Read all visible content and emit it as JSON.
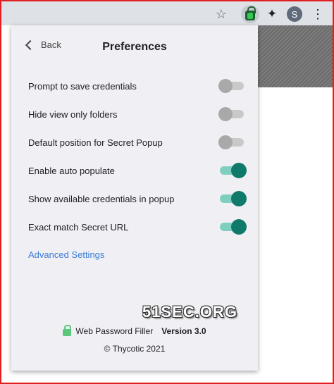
{
  "browser": {
    "avatar_letter": "S",
    "icons": [
      "star-icon",
      "lock-extension-icon",
      "puzzle-icon",
      "avatar",
      "kebab-menu-icon"
    ]
  },
  "popup": {
    "back_label": "Back",
    "title": "Preferences",
    "settings": [
      {
        "label": "Prompt to save credentials",
        "enabled": false
      },
      {
        "label": "Hide view only folders",
        "enabled": false
      },
      {
        "label": "Default position for Secret Popup",
        "enabled": false
      },
      {
        "label": "Enable auto populate",
        "enabled": true
      },
      {
        "label": "Show available credentials in popup",
        "enabled": true
      },
      {
        "label": "Exact match Secret URL",
        "enabled": true
      }
    ],
    "advanced_link": "Advanced Settings",
    "footer": {
      "product": "Web Password Filler",
      "version": "Version 3.0",
      "copyright": "© Thycotic 2021"
    }
  },
  "watermark": "51SEC.ORG",
  "colors": {
    "toggle_on": "#0f7a6a",
    "toggle_on_track": "#7fcfc0",
    "toggle_off": "#a9a9a9",
    "link": "#3a7bd5",
    "frame": "#e02020"
  }
}
